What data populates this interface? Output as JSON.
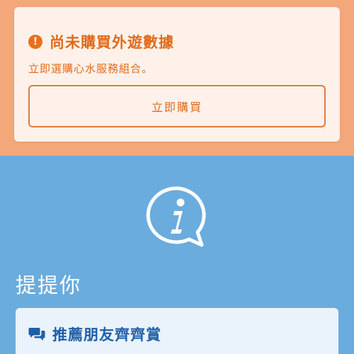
{
  "notice": {
    "title": "尚未購買外遊數據",
    "subtitle": "立即選購心水服務組合。",
    "button_label": "立即購買",
    "alert_glyph": "!",
    "alert_icon": "alert-circle-icon"
  },
  "reminder": {
    "info_icon": "info-speech-bubble-icon",
    "title": "提提你"
  },
  "recommend": {
    "icon": "chat-bubbles-icon",
    "title": "推薦朋友齊齊賞"
  },
  "colors": {
    "orange_band": "#f3a77b",
    "orange_text": "#e06a1a",
    "blue_band": "#6aacdd",
    "blue_text": "#1f5fa8"
  }
}
